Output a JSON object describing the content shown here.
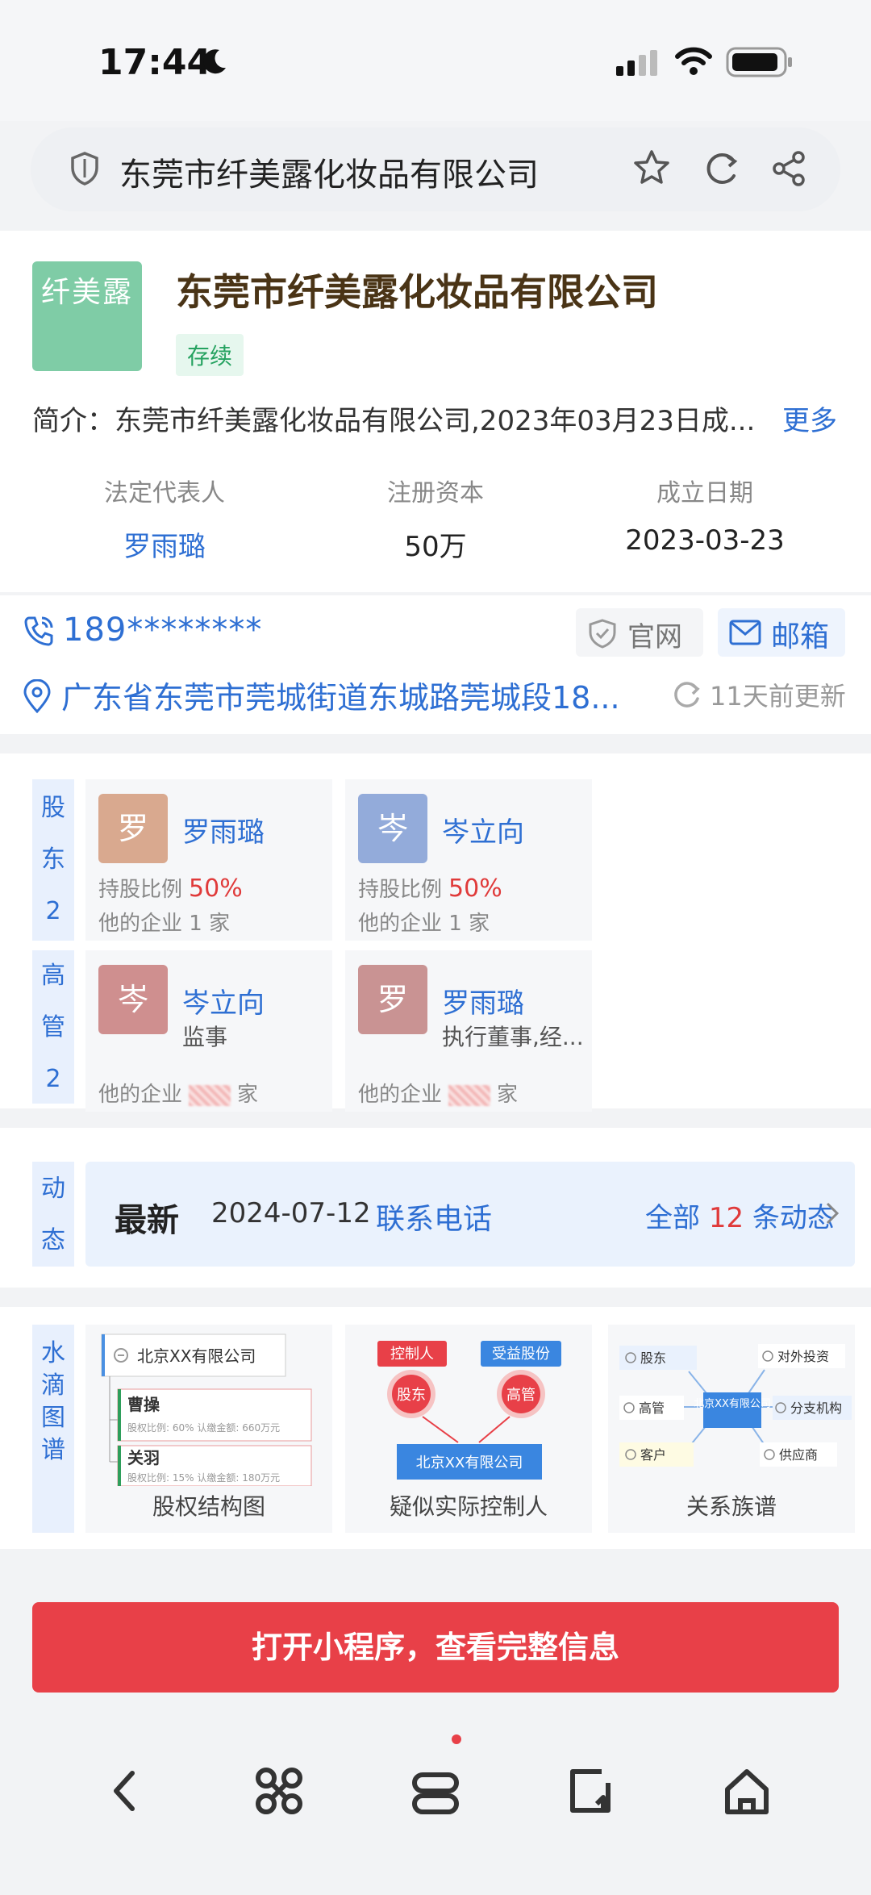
{
  "status_bar": {
    "time": "17:44"
  },
  "url_bar": {
    "title": "东莞市纤美露化妆品有限公司"
  },
  "company": {
    "logo_text": "纤美露",
    "name": "东莞市纤美露化妆品有限公司",
    "status": "存续",
    "intro": "简介：东莞市纤美露化妆品有限公司,2023年03月23日成...",
    "more_label": "更多",
    "fields": [
      {
        "key": "法定代表人",
        "value": "罗雨璐"
      },
      {
        "key": "注册资本",
        "value": "50万"
      },
      {
        "key": "成立日期",
        "value": "2023-03-23"
      }
    ]
  },
  "contact": {
    "phone": "189********",
    "website_label": "官网",
    "email_label": "邮箱",
    "address": "广东省东莞市莞城街道东城路莞城段18...",
    "updated": "11天前更新"
  },
  "shareholders": {
    "label_chars": [
      "股",
      "东",
      "2"
    ],
    "items": [
      {
        "avatar": "罗",
        "name": "罗雨璐",
        "ratio_label": "持股比例",
        "ratio": "50%",
        "other": "他的企业 1 家",
        "color": "#d9a98f"
      },
      {
        "avatar": "岑",
        "name": "岑立向",
        "ratio_label": "持股比例",
        "ratio": "50%",
        "other": "他的企业 1 家",
        "color": "#93abda"
      }
    ]
  },
  "executives": {
    "label_chars": [
      "高",
      "管",
      "2"
    ],
    "items": [
      {
        "avatar": "岑",
        "name": "岑立向",
        "title": "监事",
        "other_prefix": "他的企业",
        "other_suffix": "家",
        "color": "#cf8f8f"
      },
      {
        "avatar": "罗",
        "name": "罗雨璐",
        "title": "执行董事,经...",
        "other_prefix": "他的企业",
        "other_suffix": "家",
        "color": "#c99393"
      }
    ]
  },
  "dynamics": {
    "label_chars": [
      "动",
      "态"
    ],
    "latest_label": "最新",
    "date": "2024-07-12",
    "type": "联系电话",
    "all_prefix": "全部",
    "count": "12",
    "all_suffix": "条动态"
  },
  "graphs": {
    "label_chars": [
      "水",
      "滴",
      "图",
      "谱"
    ],
    "equity": {
      "caption": "股权结构图",
      "company": "北京XX有限公司",
      "p1_name": "曹操",
      "p1_info": "股权比例: 60%  认缴金额: 660万元",
      "p2_name": "关羽",
      "p2_info": "股权比例: 15%  认缴金额: 180万元"
    },
    "controller": {
      "caption": "疑似实际控制人",
      "tag1": "控制人",
      "tag2": "受益股份",
      "node1": "股东",
      "node2": "高管",
      "company": "北京XX有限公司"
    },
    "relation": {
      "caption": "关系族谱",
      "center": "北京XX有限公司",
      "n1": "股东",
      "n2": "对外投资",
      "n3": "高管",
      "n4": "分支机构",
      "n5": "客户",
      "n6": "供应商"
    }
  },
  "cta": {
    "label": "打开小程序，查看完整信息"
  }
}
